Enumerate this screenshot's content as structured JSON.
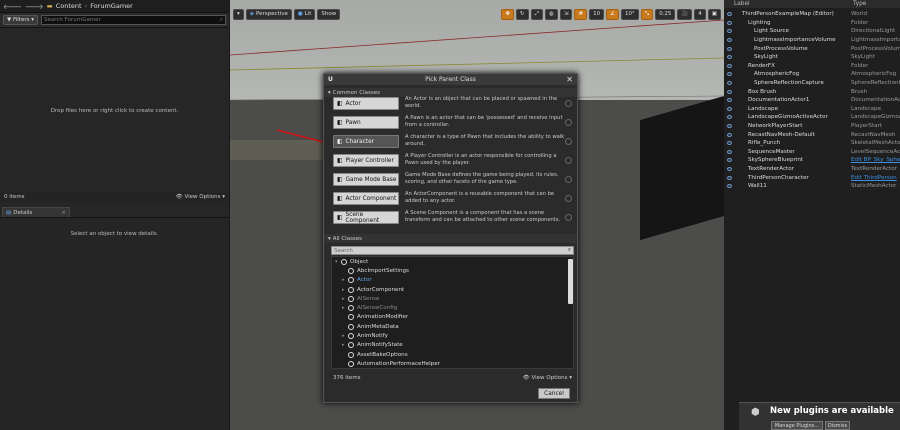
{
  "content_browser": {
    "breadcrumb": [
      "Content",
      "ForumGamer"
    ],
    "filters_label": "Filters",
    "search_placeholder": "Search ForumGamer",
    "empty_message": "Drop files here or right click to create content.",
    "item_count": "0 items",
    "view_options": "View Options"
  },
  "details": {
    "tab_label": "Details",
    "empty_message": "Select an object to view details."
  },
  "viewport": {
    "perspective": "Perspective",
    "lit": "Lit",
    "show": "Show",
    "grid_snap": "10",
    "rot_snap": "10°",
    "scale_snap": "0.25",
    "camera_speed": "4"
  },
  "outliner": {
    "col_label": "Label",
    "col_type": "Type",
    "rows": [
      {
        "label": "ThirdPersonExampleMap (Editor)",
        "type": "World",
        "indent": 1
      },
      {
        "label": "Lighting",
        "type": "Folder",
        "indent": 2
      },
      {
        "label": "Light Source",
        "type": "DirectionalLight",
        "indent": 3
      },
      {
        "label": "LightmassImportanceVolume",
        "type": "LightmassImportanceV",
        "indent": 3
      },
      {
        "label": "PostProcessVolume",
        "type": "PostProcessVolume",
        "indent": 3
      },
      {
        "label": "SkyLight",
        "type": "SkyLight",
        "indent": 3
      },
      {
        "label": "RenderFX",
        "type": "Folder",
        "indent": 2
      },
      {
        "label": "AtmosphericFog",
        "type": "AtmosphericFog",
        "indent": 3
      },
      {
        "label": "SphereReflectionCapture",
        "type": "SphereReflectionCa",
        "indent": 3
      },
      {
        "label": "Box Brush",
        "type": "Brush",
        "indent": 2
      },
      {
        "label": "DocumentationActor1",
        "type": "DocumentationActor",
        "indent": 2
      },
      {
        "label": "Landscape",
        "type": "Landscape",
        "indent": 2
      },
      {
        "label": "LandscapeGizmoActiveActor",
        "type": "LandscapeGizmoActi",
        "indent": 2
      },
      {
        "label": "NetworkPlayerStart",
        "type": "PlayerStart",
        "indent": 2
      },
      {
        "label": "RecastNavMesh-Default",
        "type": "RecastNavMesh",
        "indent": 2
      },
      {
        "label": "Rifle_Punch",
        "type": "SkeletalMeshActor",
        "indent": 2
      },
      {
        "label": "SequenceMaster",
        "type": "LevelSequenceActor",
        "indent": 2
      },
      {
        "label": "SkySphereBlueprint",
        "type": "Edit BP_Sky_Sphe",
        "indent": 2,
        "link": true
      },
      {
        "label": "TextRenderActor",
        "type": "TextRenderActor",
        "indent": 2
      },
      {
        "label": "ThirdPersonCharacter",
        "type": "Edit ThirdPerson",
        "indent": 2,
        "link": true
      },
      {
        "label": "Wall11",
        "type": "StaticMeshActor",
        "indent": 2
      }
    ]
  },
  "dialog": {
    "title": "Pick Parent Class",
    "common_classes_label": "Common Classes",
    "common_classes": [
      {
        "name": "Actor",
        "desc": "An Actor is an object that can be placed or spawned in the world."
      },
      {
        "name": "Pawn",
        "desc": "A Pawn is an actor that can be 'possessed' and receive input from a controller."
      },
      {
        "name": "Character",
        "desc": "A character is a type of Pawn that includes the ability to walk around."
      },
      {
        "name": "Player Controller",
        "desc": "A Player Controller is an actor responsible for controlling a Pawn used by the player."
      },
      {
        "name": "Game Mode Base",
        "desc": "Game Mode Base defines the game being played, its rules, scoring, and other facets of the game type."
      },
      {
        "name": "Actor Component",
        "desc": "An ActorComponent is a reusable component that can be added to any actor."
      },
      {
        "name": "Scene Component",
        "desc": "A Scene Component is a component that has a scene transform and can be attached to other scene components."
      }
    ],
    "all_classes_label": "All Classes",
    "search_placeholder": "Search",
    "tree": [
      {
        "label": "Object",
        "depth": 0,
        "arrow": "▾"
      },
      {
        "label": "AbcImportSettings",
        "depth": 1,
        "arrow": ""
      },
      {
        "label": "Actor",
        "depth": 1,
        "arrow": "▸",
        "style": "blue"
      },
      {
        "label": "ActorComponent",
        "depth": 1,
        "arrow": "▸"
      },
      {
        "label": "AISense",
        "depth": 1,
        "arrow": "▸",
        "style": "dim"
      },
      {
        "label": "AISenseConfig",
        "depth": 1,
        "arrow": "▸",
        "style": "dim"
      },
      {
        "label": "AnimationModifier",
        "depth": 1,
        "arrow": ""
      },
      {
        "label": "AnimMetaData",
        "depth": 1,
        "arrow": ""
      },
      {
        "label": "AnimNotify",
        "depth": 1,
        "arrow": "▸"
      },
      {
        "label": "AnimNotifyState",
        "depth": 1,
        "arrow": "▸"
      },
      {
        "label": "AssetBakeOptions",
        "depth": 1,
        "arrow": ""
      },
      {
        "label": "AutomationPerformaceHelper",
        "depth": 1,
        "arrow": ""
      }
    ],
    "item_count": "376 items",
    "view_options": "View Options",
    "cancel": "Cancel"
  },
  "notification": {
    "title": "New plugins are available",
    "manage": "Manage Plugins...",
    "dismiss": "Dismiss"
  }
}
